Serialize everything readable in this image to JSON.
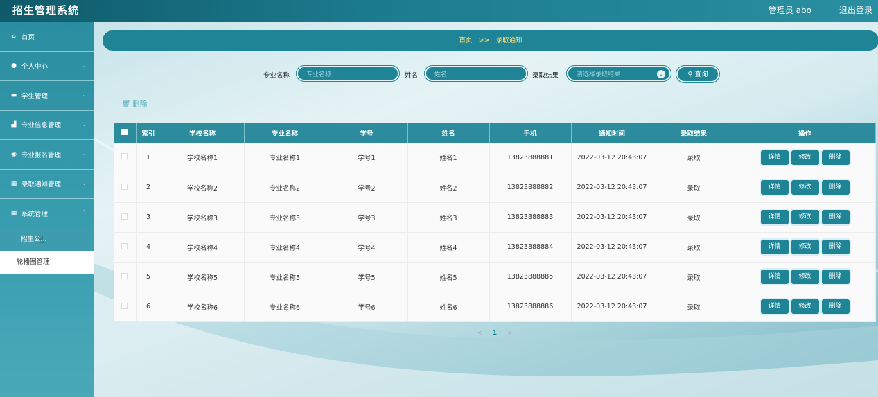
{
  "header": {
    "title": "招生管理系统",
    "admin_label": "管理员 abo",
    "logout_label": "退出登录"
  },
  "sidebar": {
    "items": [
      {
        "label": "首页",
        "icon": "home-icon"
      },
      {
        "label": "个人中心",
        "icon": "user-icon"
      },
      {
        "label": "学生管理",
        "icon": "building-icon"
      },
      {
        "label": "专业信息管理",
        "icon": "chart-icon"
      },
      {
        "label": "专业报名管理",
        "icon": "pin-icon"
      },
      {
        "label": "录取通知管理",
        "icon": "grid-icon"
      },
      {
        "label": "系统管理",
        "icon": "grid-icon"
      }
    ],
    "sub_items": [
      {
        "label": "招生公..."
      },
      {
        "label": "轮播图管理"
      }
    ]
  },
  "breadcrumb": {
    "home": "首页",
    "sep": ">>",
    "current": "录取通知"
  },
  "search": {
    "major_label": "专业名称",
    "major_placeholder": "专业名称",
    "name_label": "姓名",
    "name_placeholder": "姓名",
    "result_label": "录取结果",
    "result_placeholder": "请选择录取结果",
    "query_label": "查询"
  },
  "actions": {
    "delete_label": "删除"
  },
  "table": {
    "headers": [
      "",
      "索引",
      "学校名称",
      "专业名称",
      "学号",
      "姓名",
      "手机",
      "通知时间",
      "录取结果",
      "操作"
    ],
    "row_actions": [
      "详情",
      "修改",
      "删除"
    ],
    "rows": [
      {
        "index": "1",
        "school": "学校名称1",
        "major": "专业名称1",
        "student_no": "学号1",
        "name": "姓名1",
        "phone": "13823888881",
        "time": "2022-03-12 20:43:07",
        "result": "录取"
      },
      {
        "index": "2",
        "school": "学校名称2",
        "major": "专业名称2",
        "student_no": "学号2",
        "name": "姓名2",
        "phone": "13823888882",
        "time": "2022-03-12 20:43:07",
        "result": "录取"
      },
      {
        "index": "3",
        "school": "学校名称3",
        "major": "专业名称3",
        "student_no": "学号3",
        "name": "姓名3",
        "phone": "13823888883",
        "time": "2022-03-12 20:43:07",
        "result": "录取"
      },
      {
        "index": "4",
        "school": "学校名称4",
        "major": "专业名称4",
        "student_no": "学号4",
        "name": "姓名4",
        "phone": "13823888884",
        "time": "2022-03-12 20:43:07",
        "result": "录取"
      },
      {
        "index": "5",
        "school": "学校名称5",
        "major": "专业名称5",
        "student_no": "学号5",
        "name": "姓名5",
        "phone": "13823888885",
        "time": "2022-03-12 20:43:07",
        "result": "录取"
      },
      {
        "index": "6",
        "school": "学校名称6",
        "major": "专业名称6",
        "student_no": "学号6",
        "name": "姓名6",
        "phone": "13823888886",
        "time": "2022-03-12 20:43:07",
        "result": "录取"
      }
    ]
  },
  "pagination": {
    "prev": "<",
    "current": "1",
    "next": ">"
  },
  "colors": {
    "primary": "#1f8596",
    "header": "#0f5a6a",
    "breadcrumb_text": "#ffe37a"
  }
}
